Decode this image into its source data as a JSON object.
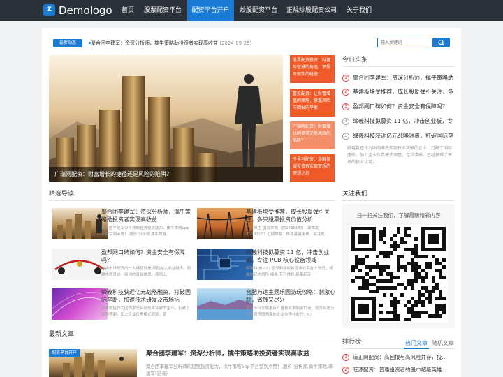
{
  "nav": {
    "logo_mark": "Z",
    "logo_text": "Demologo",
    "items": [
      {
        "label": "首页"
      },
      {
        "label": "股票配资平台"
      },
      {
        "label": "配资平台开户"
      },
      {
        "label": "炒股配资平台"
      },
      {
        "label": "正规炒股配资公司"
      },
      {
        "label": "关于我们"
      }
    ],
    "active_index": 2
  },
  "ticker": {
    "badge": "最新动态",
    "text": "聚合团李建军：资深分析师，擒牛策略助投资者实现高收益",
    "date": "(2024-09-25)"
  },
  "search": {
    "placeholder": "输入关键词"
  },
  "hero": {
    "caption": "广瑞网配资：财富增长的捷径还是风险的陷阱？"
  },
  "tiles": [
    {
      "text": "股票配资投资：财富与智慧的角逐，梦想与现实的碰撞",
      "color": "#f05a28"
    },
    {
      "text": "富投配资：让财富增值的策略，掌握风险与回报的平衡",
      "color": "#f05a28"
    },
    {
      "text": "广瑞网配资：财富增长的捷径还是风险的陷阱？",
      "color": "#f58f6a"
    },
    {
      "text": "千里马配资：金融领域投资者实现梦想的理想之地",
      "color": "#f05a28"
    }
  ],
  "headlines": {
    "title": "今日头条",
    "items": [
      {
        "num": "1",
        "text": "聚合团李建军：资深分析师，擒牛策略助"
      },
      {
        "num": "2",
        "text": "基建板块受推荐，成长股反弹引关注，多"
      },
      {
        "num": "3",
        "text": "盈邦网口碑如何？资金安全有保障吗？"
      },
      {
        "num": "4",
        "text": "缔羲科技拟募资 11 亿，冲击创业板，专"
      },
      {
        "num": "5",
        "text": "缔羲科技获近亿元战略融资，打破国际垄"
      }
    ],
    "summary": "缔羲数控作为国内率先实现技术突破的企业，打破了国际垄断。加上企业负责模式调整，定位清晰，已经获得了市场的极大认可。..."
  },
  "guide": {
    "title": "精选导读",
    "items": [
      {
        "title": "聚合团李建军：资深分析师，擒牛策略助投资者实现高收益",
        "desc": "聚合团李建军分析师的超强投资能力，擒牛策略app平台受到点赞！,股价,分析师,擒牛策略,"
      },
      {
        "title": "基建板块受推荐，成长股反弹引关注，多只股票投资价值分析",
        "desc": "广证恒生-国海策略（第27351期）：政策助力-181107 近期策略：推荐基建板块，关注成"
      },
      {
        "title": "盈邦网口碑如何？资金安全有保障吗？",
        "desc": "自由市场经济的一大特征就是,风险越大收益越大。股票市场是这一原则的直接体现，原则上"
      },
      {
        "title": "缔羲科技拟募资 11 亿，冲击创业板，专注 PCB 核心设备领域",
        "desc": "缔羲科技IPO | 因专利侵权被竞争对手告上法庭，或能崛起大风险,缔羲,专利侵权,民事起诉"
      },
      {
        "title": "缔羲科技获近亿元战略融资，打破国际垄断，加速技术研发及市场拓",
        "desc": "缔羲数控作为国内率先实现技术突破的企业，打破了国际垄断。加上企业负责模式调整，定"
      },
      {
        "title": "合肥万达主题乐园游玩攻略：刺激心跳，省钱又尽兴",
        "desc": "各大节日去哪里玩？善意寻求刺激的话，就去合肥万达主题乐园吧离的企业你不往此行，心"
      }
    ]
  },
  "follow": {
    "title": "关注我们",
    "text": "扫一扫关注我们，了解最新精彩内容"
  },
  "latest": {
    "title": "最新文章",
    "badge": "配资平台开户",
    "item_title": "聚合团李建军：资深分析师，擒牛策略助投资者实现高收益",
    "item_desc": "聚合团李建军分析师的超强投资能力，擒牛策略app平台受到点赞！,股价,分析师,擒牛策略,李建军(记者)"
  },
  "ranking": {
    "title": "排行榜",
    "tab_active": "热门文章",
    "tab": "随机文章",
    "items": [
      {
        "num": "1",
        "text": "道正网配资：高回报与高风险并存，投..."
      },
      {
        "num": "2",
        "text": "旺源配资：普通投资者的股市超级英雄..."
      }
    ]
  },
  "colors": {
    "accent": "#1a7bd6",
    "tile": "#f05a28",
    "nav_bg": "#2a3138"
  }
}
